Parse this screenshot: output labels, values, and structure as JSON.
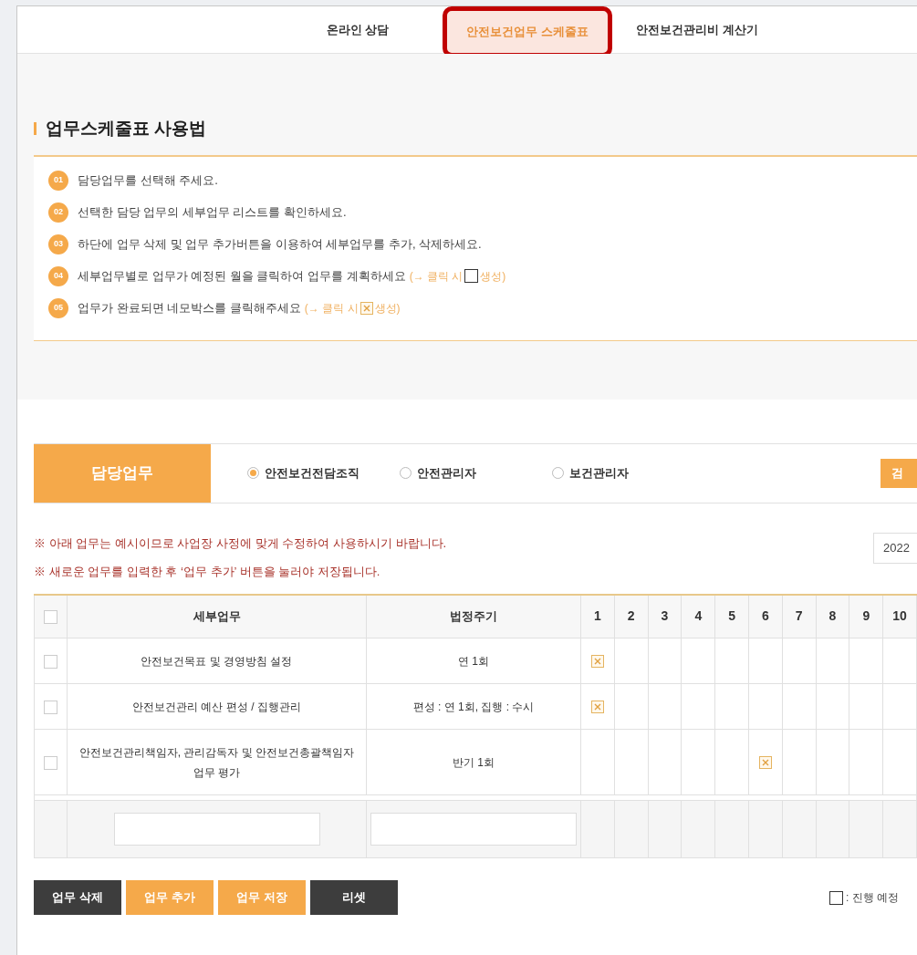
{
  "nav_tabs": [
    {
      "label": "온라인 상담",
      "selected": false
    },
    {
      "label": "안전보건업무 스케줄표",
      "selected": true
    },
    {
      "label": "안전보건관리비 계산기",
      "selected": false
    }
  ],
  "guide": {
    "title": "업무스케줄표 사용법",
    "steps": [
      {
        "number": "01",
        "text": "담당업무를 선택해 주세요."
      },
      {
        "number": "02",
        "text": "선택한 담당 업무의 세부업무 리스트를 확인하세요."
      },
      {
        "number": "03",
        "text": "하단에 업무 삭제 및 업무 추가버튼을 이용하여 세부업무를 추가, 삭제하세요."
      },
      {
        "number": "04",
        "text": "세부업무별로 업무가 예정된 월을 클릭하여 업무를 계획하세요",
        "hint_before": "(→ 클릭 시",
        "hint_box_done": false,
        "hint_after": "생성)"
      },
      {
        "number": "05",
        "text": "업무가 완료되면 네모박스를 클릭해주세요",
        "hint_before": "(→ 클릭 시",
        "hint_box_done": true,
        "hint_after": "생성)"
      }
    ]
  },
  "duty": {
    "label": "담당업무",
    "options": [
      {
        "label": "안전보건전담조직",
        "selected": true
      },
      {
        "label": "안전관리자",
        "selected": false
      },
      {
        "label": "보건관리자",
        "selected": false
      }
    ],
    "search_button": "검"
  },
  "notices": [
    "※ 아래 업무는 예시이므로 사업장 사정에 맞게 수정하여 사용하시기 바랍니다.",
    "※ 새로운 업무를 입력한 후 ‘업무 추가’ 버튼을 눌러야 저장됩니다."
  ],
  "year": "2022",
  "table": {
    "columns": [
      "세부업무",
      "법정주기"
    ],
    "months": [
      "1",
      "2",
      "3",
      "4",
      "5",
      "6",
      "7",
      "8",
      "9",
      "10"
    ],
    "header_checked": false,
    "rows": [
      {
        "checked": false,
        "task": "안전보건목표 및 경영방침 설정",
        "cycle": "연 1회",
        "months": [
          {
            "done": true
          },
          {
            "done": false
          },
          {
            "done": false
          },
          {
            "done": false
          },
          {
            "done": false
          },
          {
            "done": false
          },
          {
            "done": false
          },
          {
            "done": false
          },
          {
            "done": false
          },
          {
            "done": false
          }
        ]
      },
      {
        "checked": false,
        "task": "안전보건관리 예산 편성 / 집행관리",
        "cycle": "편성 : 연 1회, 집행 : 수시",
        "months": [
          {
            "done": true
          },
          {
            "done": false
          },
          {
            "done": false
          },
          {
            "done": false
          },
          {
            "done": false
          },
          {
            "done": false
          },
          {
            "done": false
          },
          {
            "done": false
          },
          {
            "done": false
          },
          {
            "done": false
          }
        ]
      },
      {
        "checked": false,
        "task": "안전보건관리책임자, 관리감독자 및 안전보건총괄책임자 업무 평가",
        "cycle": "반기 1회",
        "months": [
          {
            "done": false
          },
          {
            "done": false
          },
          {
            "done": false
          },
          {
            "done": false
          },
          {
            "done": false
          },
          {
            "done": true
          },
          {
            "done": false
          },
          {
            "done": false
          },
          {
            "done": false
          },
          {
            "done": false
          }
        ]
      }
    ]
  },
  "buttons": [
    {
      "label": "업무 삭제",
      "kind": "dark"
    },
    {
      "label": "업무 추가",
      "kind": "orange"
    },
    {
      "label": "업무 저장",
      "kind": "orange"
    },
    {
      "label": "리셋",
      "kind": "dark"
    }
  ],
  "legend": [
    {
      "box_done": false,
      "label": ": 진행 예정"
    }
  ]
}
